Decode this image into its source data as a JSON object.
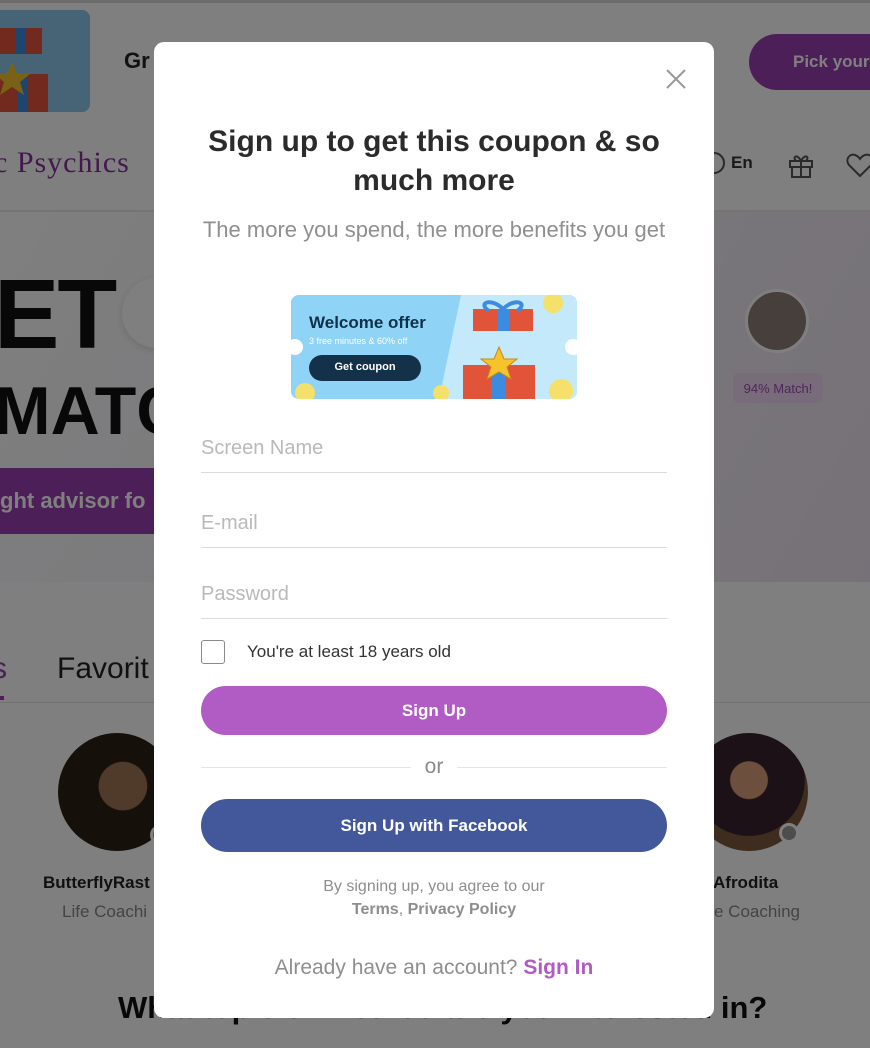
{
  "background": {
    "promo_title": "Gr",
    "pick_button": "Pick your",
    "brand": "c Psychics",
    "language": "En",
    "hero_line1": "ET",
    "hero_line2": "MATC",
    "hero_button": "ght advisor fo",
    "match_label": "94% Match!",
    "tabs": {
      "active": "s",
      "favorites": "Favorit"
    },
    "advisors": [
      {
        "name": "ButterflyRast",
        "category": "Life Coachi"
      },
      {
        "name": "Afrodita",
        "category": "e Coaching"
      }
    ],
    "bottom_question": "What topic or method are you interested in?"
  },
  "modal": {
    "title": "Sign up to get this coupon & so much more",
    "subtitle": "The more you spend, the more benefits you get",
    "coupon": {
      "title": "Welcome offer",
      "subtitle": "3 free minutes & 60% off",
      "button": "Get coupon"
    },
    "fields": {
      "screen_name_placeholder": "Screen Name",
      "email_placeholder": "E-mail",
      "password_placeholder": "Password"
    },
    "age_label": "You're at least 18 years old",
    "signup_button": "Sign Up",
    "or": "or",
    "facebook_button": "Sign Up with Facebook",
    "legal_text": "By signing up, you agree to our",
    "terms": "Terms",
    "separator": ",",
    "privacy": "Privacy Policy",
    "account_question": "Already have an account?",
    "sign_in": "Sign In"
  },
  "colors": {
    "primary": "#b15bc4",
    "facebook": "#43589b",
    "brand": "#8a2f9e"
  }
}
